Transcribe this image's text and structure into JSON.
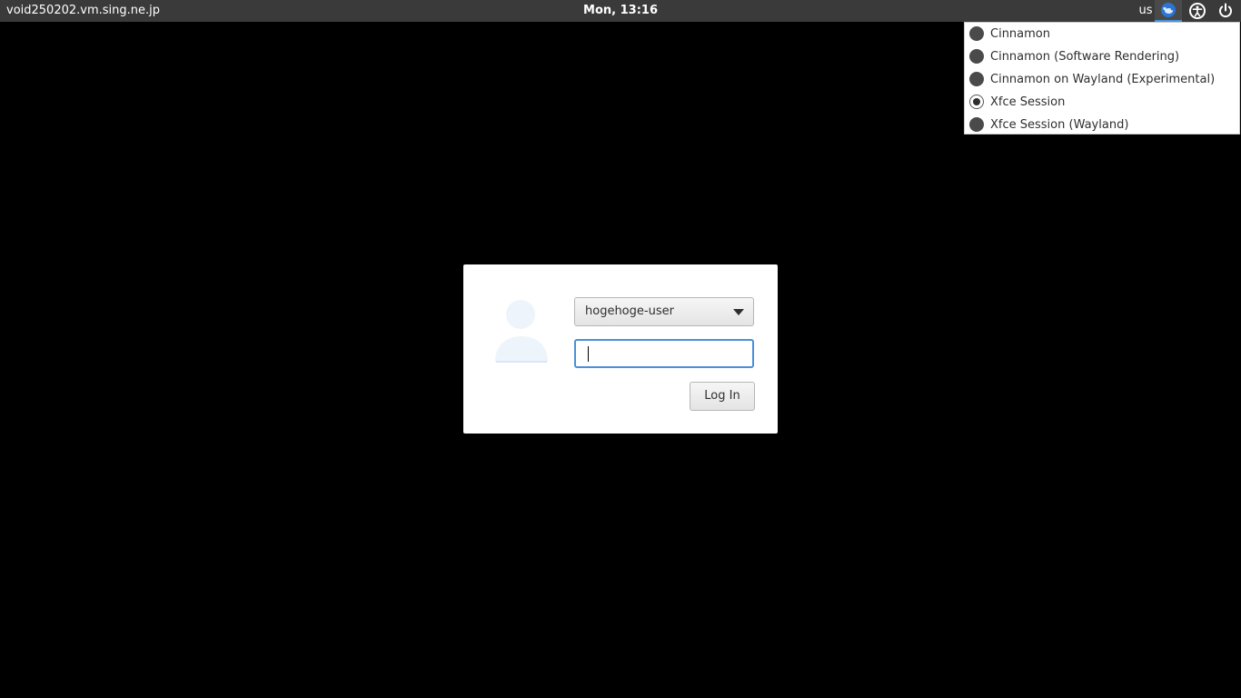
{
  "topbar": {
    "hostname": "void250202.vm.sing.ne.jp",
    "clock": "Mon, 13:16",
    "keyboard_layout": "us",
    "session_icon": "xfce-mouse-icon",
    "accessibility_icon": "accessibility-icon",
    "power_icon": "power-icon"
  },
  "session_menu": {
    "items": [
      {
        "label": "Cinnamon",
        "selected": false
      },
      {
        "label": "Cinnamon (Software Rendering)",
        "selected": false
      },
      {
        "label": "Cinnamon on Wayland (Experimental)",
        "selected": false
      },
      {
        "label": "Xfce Session",
        "selected": true
      },
      {
        "label": "Xfce Session (Wayland)",
        "selected": false
      }
    ]
  },
  "login": {
    "avatar_icon": "user-avatar-icon",
    "selected_user": "hogehoge-user",
    "password_value": "",
    "login_label": "Log In"
  },
  "colors": {
    "topbar_bg": "#3a3a3a",
    "focus_accent": "#4a90d9",
    "background": "#000000"
  }
}
